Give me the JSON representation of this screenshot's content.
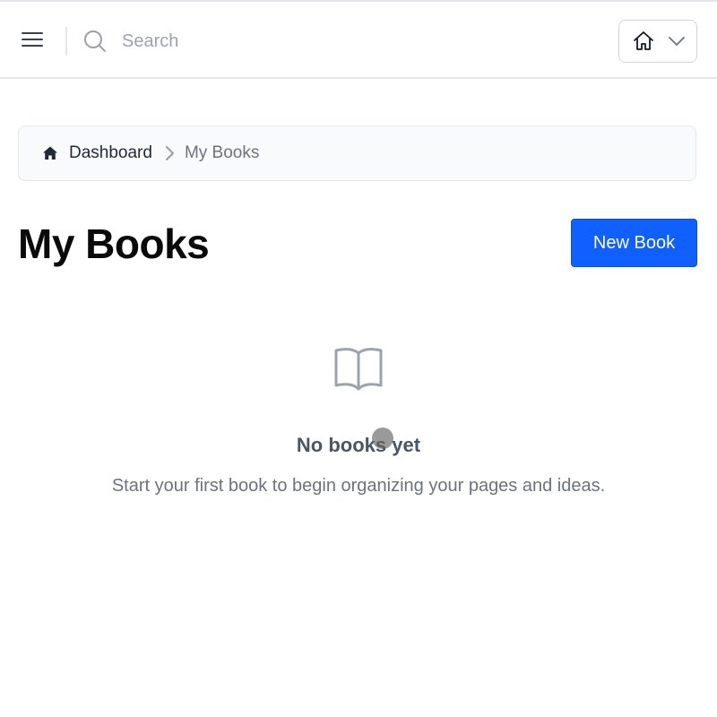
{
  "header": {
    "search": {
      "placeholder": "Search",
      "value": ""
    },
    "icons": {
      "menu": "hamburger-menu-icon",
      "search": "search-icon",
      "home": "home-icon",
      "dropdown": "chevron-down-icon"
    }
  },
  "breadcrumb": {
    "items": [
      {
        "label": "Dashboard",
        "icon": "home-icon"
      },
      {
        "label": "My Books"
      }
    ]
  },
  "main": {
    "title": "My Books",
    "new_book_label": "New Book"
  },
  "empty_state": {
    "icon": "open-book-icon",
    "title": "No books yet",
    "description": "Start your first book to begin organizing your pages and ideas."
  },
  "colors": {
    "primary": "#1060ff",
    "border": "#e5e7eb",
    "muted_text": "#6b7280",
    "breadcrumb_bg": "#f9fafb"
  }
}
